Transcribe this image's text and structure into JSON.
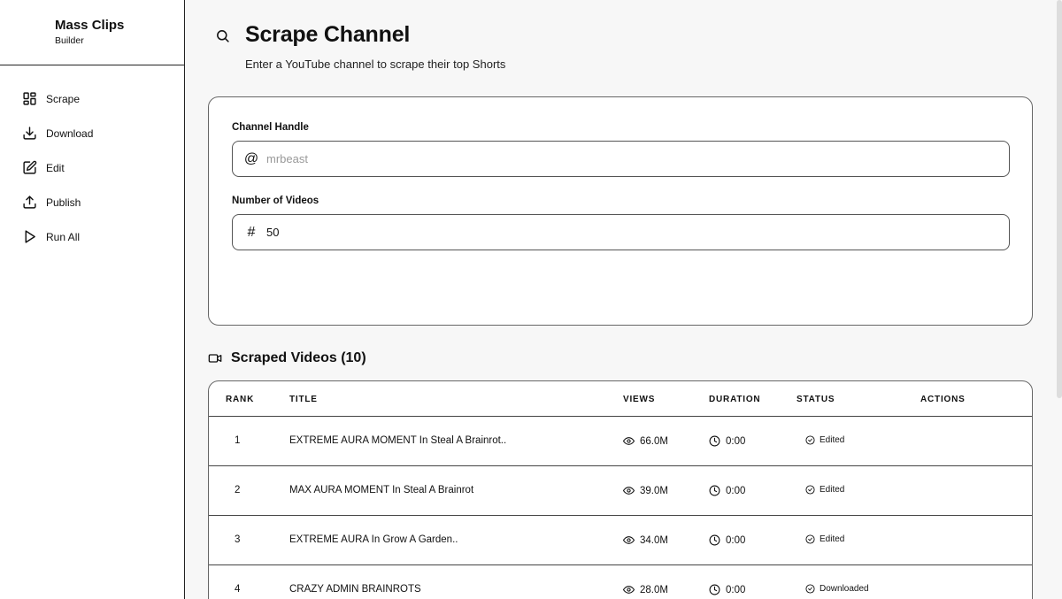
{
  "brand": {
    "title": "Mass Clips",
    "subtitle": "Builder"
  },
  "sidebar": {
    "items": [
      {
        "label": "Scrape",
        "icon": "grid-icon"
      },
      {
        "label": "Download",
        "icon": "download-icon"
      },
      {
        "label": "Edit",
        "icon": "edit-icon"
      },
      {
        "label": "Publish",
        "icon": "upload-icon"
      },
      {
        "label": "Run All",
        "icon": "play-icon"
      }
    ]
  },
  "header": {
    "title": "Scrape Channel",
    "subtitle": "Enter a YouTube channel to scrape their top Shorts"
  },
  "form": {
    "channel_label": "Channel Handle",
    "channel_icon": "@",
    "channel_placeholder": "mrbeast",
    "count_label": "Number of Videos",
    "count_icon": "#",
    "count_value": "50"
  },
  "videos": {
    "title": "Scraped Videos (10)",
    "columns": {
      "rank": "RANK",
      "title": "TITLE",
      "views": "VIEWS",
      "duration": "DURATION",
      "status": "STATUS",
      "actions": "ACTIONS"
    },
    "rows": [
      {
        "rank": "1",
        "title": "EXTREME AURA MOMENT In Steal A Brainrot..",
        "views": "66.0M",
        "duration": "0:00",
        "status": "Edited"
      },
      {
        "rank": "2",
        "title": "MAX AURA MOMENT In Steal A Brainrot",
        "views": "39.0M",
        "duration": "0:00",
        "status": "Edited"
      },
      {
        "rank": "3",
        "title": "EXTREME AURA In Grow A Garden..",
        "views": "34.0M",
        "duration": "0:00",
        "status": "Edited"
      },
      {
        "rank": "4",
        "title": "CRAZY ADMIN BRAINROTS",
        "views": "28.0M",
        "duration": "0:00",
        "status": "Downloaded"
      }
    ]
  },
  "colors": {
    "accent": "#111111",
    "border": "#666666",
    "background": "#f7f7f7"
  }
}
